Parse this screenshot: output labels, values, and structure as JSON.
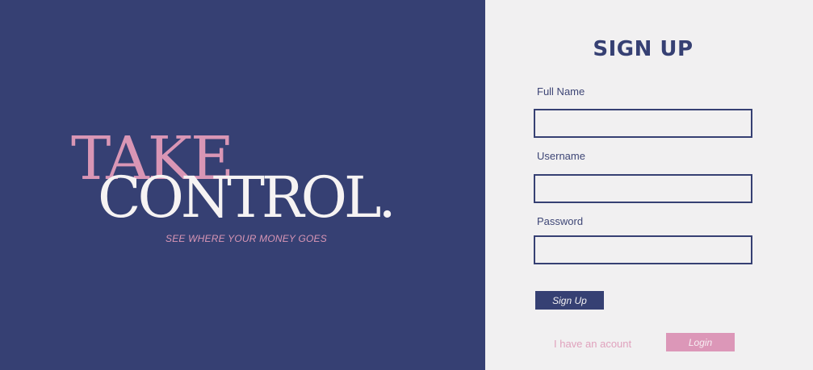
{
  "hero": {
    "line1": "TAKE",
    "line2": "CONTROL.",
    "tagline": "SEE WHERE YOUR MONEY GOES"
  },
  "form": {
    "title": "SIGN UP",
    "fields": [
      {
        "label": "Full Name",
        "value": "",
        "placeholder": ""
      },
      {
        "label": "Username",
        "value": "",
        "placeholder": ""
      },
      {
        "label": "Password",
        "value": "",
        "placeholder": ""
      }
    ],
    "submit_label": "Sign Up",
    "account_prompt": "I have an acount",
    "login_label": "Login"
  },
  "colors": {
    "navy": "#364073",
    "pink": "#d996b5",
    "panel_bg": "#f1f0f1",
    "white_text": "#f6f3f3"
  }
}
